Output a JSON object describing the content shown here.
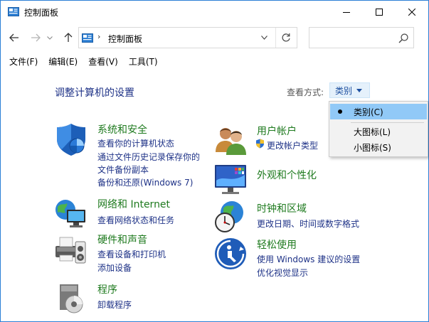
{
  "window": {
    "title": "控制面板",
    "controls": {
      "minimize": "minimize",
      "maximize": "maximize",
      "close": "close"
    }
  },
  "nav": {
    "address": {
      "separator": "›",
      "location": "控制面板"
    },
    "search": {
      "placeholder": ""
    }
  },
  "menu": [
    "文件(F)",
    "编辑(E)",
    "查看(V)",
    "工具(T)"
  ],
  "main": {
    "heading": "调整计算机的设置",
    "view_by_label": "查看方式:",
    "view_by_value": "类别"
  },
  "categories": [
    {
      "title": "系统和安全",
      "icon": "shield-icon",
      "links": [
        "查看你的计算机状态",
        "通过文件历史记录保存你的",
        "文件备份副本",
        "备份和还原(Windows 7)"
      ]
    },
    {
      "title": "网络和 Internet",
      "icon": "network-icon",
      "links": [
        "查看网络状态和任务"
      ]
    },
    {
      "title": "硬件和声音",
      "icon": "printer-icon",
      "links": [
        "查看设备和打印机",
        "添加设备"
      ]
    },
    {
      "title": "程序",
      "icon": "programs-icon",
      "links": [
        "卸载程序"
      ]
    },
    {
      "title": "用户帐户",
      "icon": "users-icon",
      "links": [
        "更改帐户类型"
      ]
    },
    {
      "title": "外观和个性化",
      "icon": "monitor-icon",
      "links": []
    },
    {
      "title": "时钟和区域",
      "icon": "clock-icon",
      "links": [
        "更改日期、时间或数字格式"
      ]
    },
    {
      "title": "轻松使用",
      "icon": "ease-of-access-icon",
      "links": [
        "使用 Windows 建议的设置",
        "优化视觉显示"
      ]
    }
  ],
  "view_menu": {
    "items": [
      "类别(C)",
      "大图标(L)",
      "小图标(S)"
    ],
    "selected": "类别(C)"
  },
  "colors": {
    "accent": "#2b7fd6",
    "category_title": "#1e7a1e",
    "link": "#1e3287",
    "menu_highlight": "#91c9f7"
  }
}
